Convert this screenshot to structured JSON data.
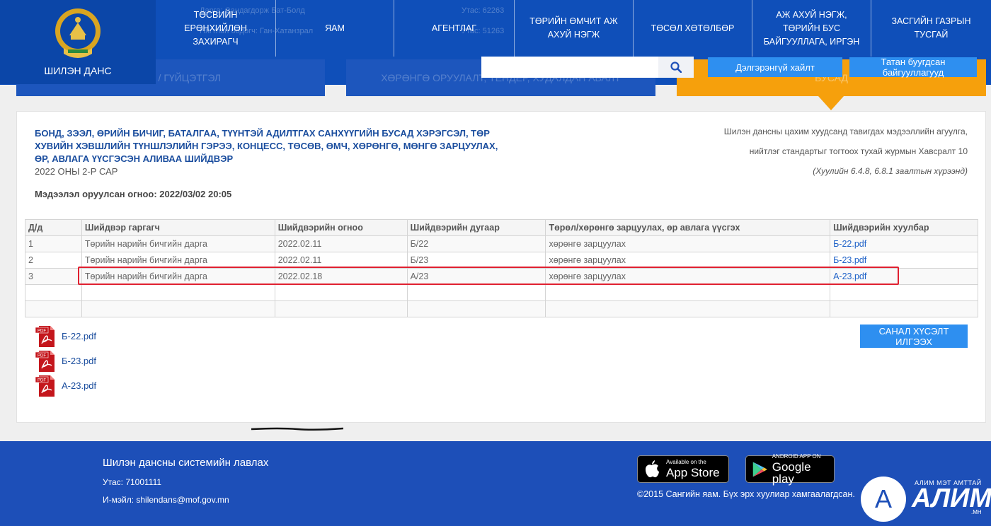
{
  "header": {
    "logo_text": "ШИЛЭН ДАНС",
    "ghost": {
      "line1_left": "Дарга: Сандагдорж Бат-Болд",
      "line2_left": "Нягтлан бодогч: Ган-Хатанзрал",
      "line1_right": "Утас: 62263",
      "line2_right": "Утас: 51263"
    },
    "nav": [
      {
        "label": "ТӨСВИЙН ЕРӨНХИЙЛӨН ЗАХИРАГЧ"
      },
      {
        "label": "ЯАМ"
      },
      {
        "label": "АГЕНТЛАГ"
      },
      {
        "label": "ТӨРИЙН ӨМЧИТ АЖ АХУЙ НЭГЖ"
      },
      {
        "label": "ТӨСӨЛ ХӨТӨЛБӨР"
      },
      {
        "label": "АЖ АХУЙ НЭГЖ, ТӨРИЙН БУС БАЙГУУЛЛАГА, ИРГЭН"
      },
      {
        "label": "ЗАСГИЙН ГАЗРЫН ТУСГАЙ"
      }
    ]
  },
  "tabs": {
    "tab1": "ТӨСӨВ / ГҮЙЦЭТГЭЛ",
    "tab2": "ХӨРӨНГӨ ОРУУЛАЛТ, ТЕНДЕР, ХУДАЛДАН АВАЛТ",
    "tab3": "БУСАД"
  },
  "search": {
    "placeholder": "",
    "advanced_label": "Дэлгэрэнгүй хайлт",
    "orgs_label": "Татан буугдсан байгууллагууд"
  },
  "document": {
    "title": "БОНД, ЗЭЭЛ, ӨРИЙН БИЧИГ, БАТАЛГАА, ТҮҮНТЭЙ АДИЛТГАХ САНХҮҮГИЙН БУСАД ХЭРЭГСЭЛ, ТӨР ХУВИЙН ХЭВШЛИЙН ТҮНШЛЭЛИЙН ГЭРЭЭ, КОНЦЕСС, ТӨСӨВ, ӨМЧ, ХӨРӨНГӨ, МӨНГӨ ЗАРЦУУЛАХ, ӨР, АВЛАГА ҮҮСГЭСЭН АЛИВАА ШИЙДВЭР",
    "period": "2022 ОНЫ 2-Р САР",
    "entry_date": "Мэдээлэл оруулсан огноо: 2022/03/02 20:05",
    "law_ref_line1": "Шилэн дансны цахим хуудсанд тавигдах мэдээллийн агуулга,",
    "law_ref_line2": "нийтлэг стандартыг тогтоох тухай журмын Хавсралт 10",
    "law_ref_line3": "(Хуулийн 6.4.8, 6.8.1 заалтын хүрээнд)"
  },
  "table": {
    "headers": [
      "Д/д",
      "Шийдвэр гаргагч",
      "Шийдвэрийн огноо",
      "Шийдвэрийн дугаар",
      "Төрөл/хөрөнгө зарцуулах, өр авлага үүсгэх",
      "Шийдвэрийн хуулбар"
    ],
    "rows": [
      [
        "1",
        "Төрийн нарийн бичгийн дарга",
        "2022.02.11",
        "Б/22",
        "хөрөнгө зарцуулах",
        "Б-22.pdf"
      ],
      [
        "2",
        "Төрийн нарийн бичгийн дарга",
        "2022.02.11",
        "Б/23",
        "хөрөнгө зарцуулах",
        "Б-23.pdf"
      ],
      [
        "3",
        "Төрийн нарийн бичгийн дарга",
        "2022.02.18",
        "А/23",
        "хөрөнгө зарцуулах",
        "А-23.pdf"
      ],
      [
        "",
        "",
        "",
        "",
        "",
        ""
      ],
      [
        "",
        "",
        "",
        "",
        "",
        ""
      ]
    ]
  },
  "attachments": [
    "Б-22.pdf",
    "Б-23.pdf",
    "А-23.pdf"
  ],
  "feedback_label": "САНАЛ ХҮСЭЛТ ИЛГЭЭХ",
  "footer": {
    "title": "Шилэн дансны системийн лавлах",
    "phone": "Утас: 71001111",
    "email": "И-мэйл: shilendans@mof.gov.mn",
    "appstore_small": "Available on the",
    "appstore_big": "App Store",
    "googleplay_small": "ANDROID APP ON",
    "googleplay_big": "Google play",
    "copyright": "©2015 Сангийн яам. Бүх эрх хуулиар хамгаалагдсан.",
    "alim_small": "АЛИМ МЭТ АМТТАЙ",
    "alim_big": "АЛИМ",
    "alim_mn": ".МН",
    "alim_letter": "A"
  },
  "colors": {
    "header_blue": "#0f4fb9",
    "button_blue": "#2e8ff0",
    "active_tab": "#f6a00c",
    "highlight_red": "#e02030",
    "footer_blue": "#1d4fb8"
  }
}
